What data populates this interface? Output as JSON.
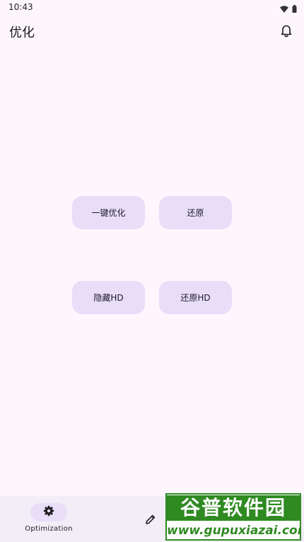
{
  "status_bar": {
    "time": "10:43",
    "icons": [
      "wifi-icon",
      "battery-icon"
    ]
  },
  "app_bar": {
    "title": "优化",
    "action_icon": "bell-icon"
  },
  "actions": {
    "optimize": "一键优化",
    "restore": "还原",
    "hide_hd": "隐藏HD",
    "restore_hd": "还原HD"
  },
  "bottom_nav": {
    "items": [
      {
        "label": "Optimization",
        "icon": "gear-icon",
        "selected": true
      },
      {
        "label": "",
        "icon": "pencil-icon",
        "selected": false
      }
    ]
  },
  "watermark": {
    "title": "谷普软件园",
    "url": "www.gupuxiazai.com"
  },
  "colors": {
    "background": "#fdf7fd",
    "button": "#e8def8",
    "nav_background": "#f3edf7",
    "watermark_green": "#2f8a22"
  }
}
